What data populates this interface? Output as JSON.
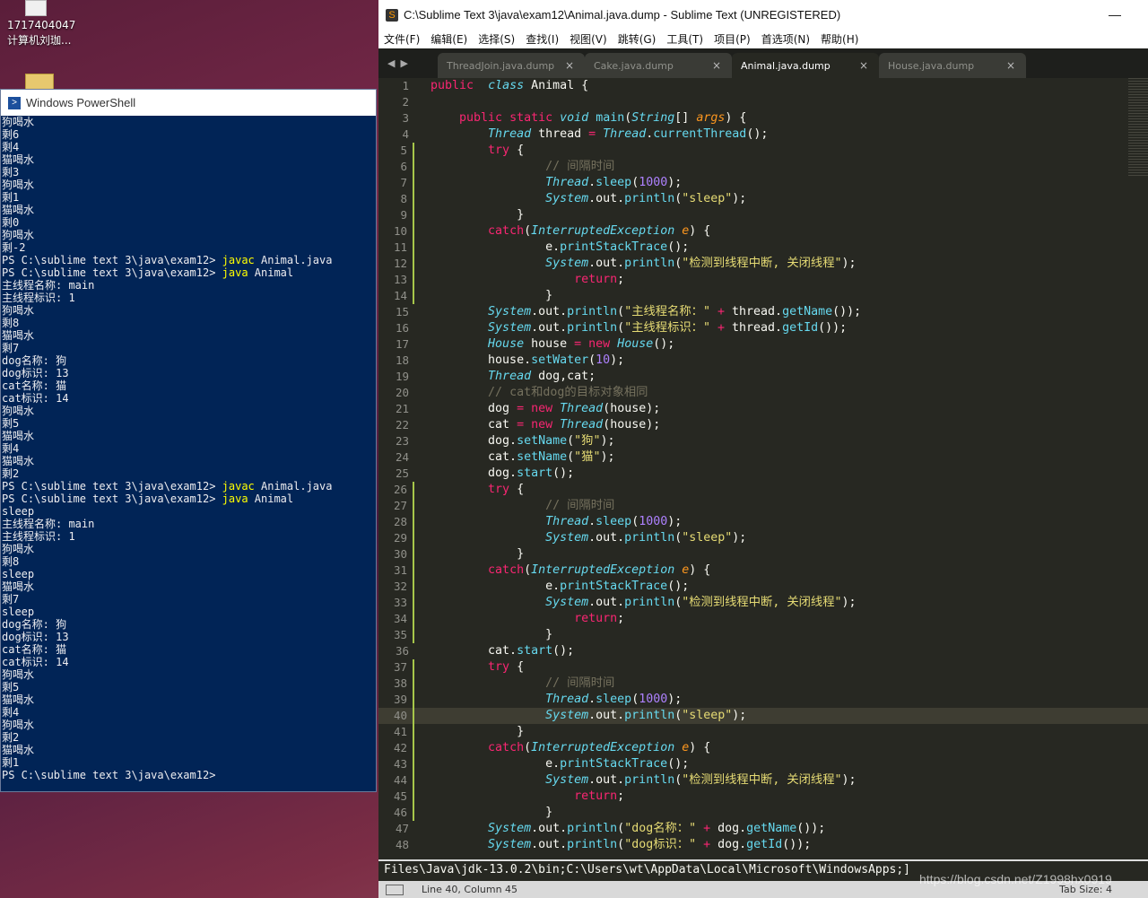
{
  "desktop": {
    "icon_label_line1": "1717404047",
    "icon_label_line2": "计算机刘珈..."
  },
  "powershell": {
    "title": "Windows PowerShell",
    "lines": [
      {
        "text": "狗喝水"
      },
      {
        "text": "剩6"
      },
      {
        "text": "剩4"
      },
      {
        "text": "猫喝水"
      },
      {
        "text": "剩3"
      },
      {
        "text": "狗喝水"
      },
      {
        "text": "剩1"
      },
      {
        "text": "猫喝水"
      },
      {
        "text": "剩0"
      },
      {
        "text": "狗喝水"
      },
      {
        "text": "剩-2"
      },
      {
        "prompt": "PS C:\\sublime text 3\\java\\exam12> ",
        "cmd": "javac",
        "arg": " Animal.java"
      },
      {
        "prompt": "PS C:\\sublime text 3\\java\\exam12> ",
        "cmd": "java",
        "arg": " Animal"
      },
      {
        "text": "主线程名称: main"
      },
      {
        "text": "主线程标识: 1"
      },
      {
        "text": "狗喝水"
      },
      {
        "text": "剩8"
      },
      {
        "text": "猫喝水"
      },
      {
        "text": "剩7"
      },
      {
        "text": "dog名称: 狗"
      },
      {
        "text": "dog标识: 13"
      },
      {
        "text": "cat名称: 猫"
      },
      {
        "text": "cat标识: 14"
      },
      {
        "text": "狗喝水"
      },
      {
        "text": "剩5"
      },
      {
        "text": "猫喝水"
      },
      {
        "text": "剩4"
      },
      {
        "text": "猫喝水"
      },
      {
        "text": "剩2"
      },
      {
        "prompt": "PS C:\\sublime text 3\\java\\exam12> ",
        "cmd": "javac",
        "arg": " Animal.java"
      },
      {
        "prompt": "PS C:\\sublime text 3\\java\\exam12> ",
        "cmd": "java",
        "arg": " Animal"
      },
      {
        "text": "sleep"
      },
      {
        "text": "主线程名称: main"
      },
      {
        "text": "主线程标识: 1"
      },
      {
        "text": "狗喝水"
      },
      {
        "text": "剩8"
      },
      {
        "text": "sleep"
      },
      {
        "text": "猫喝水"
      },
      {
        "text": "剩7"
      },
      {
        "text": "sleep"
      },
      {
        "text": "dog名称: 狗"
      },
      {
        "text": "dog标识: 13"
      },
      {
        "text": "cat名称: 猫"
      },
      {
        "text": "cat标识: 14"
      },
      {
        "text": "狗喝水"
      },
      {
        "text": "剩5"
      },
      {
        "text": "猫喝水"
      },
      {
        "text": "剩4"
      },
      {
        "text": "狗喝水"
      },
      {
        "text": "剩2"
      },
      {
        "text": "猫喝水"
      },
      {
        "text": "剩1"
      },
      {
        "text": "PS C:\\sublime text 3\\java\\exam12>"
      }
    ]
  },
  "sublime": {
    "title": "C:\\Sublime Text 3\\java\\exam12\\Animal.java.dump - Sublime Text (UNREGISTERED)",
    "minimize": "—",
    "menu": [
      "文件(F)",
      "编辑(E)",
      "选择(S)",
      "查找(I)",
      "视图(V)",
      "跳转(G)",
      "工具(T)",
      "项目(P)",
      "首选项(N)",
      "帮助(H)"
    ],
    "tabs": [
      {
        "label": "ThreadJoin.java.dump",
        "active": false
      },
      {
        "label": "Cake.java.dump",
        "active": false
      },
      {
        "label": "Animal.java.dump",
        "active": true
      },
      {
        "label": "House.java.dump",
        "active": false
      }
    ],
    "tab_close": "×",
    "code_lines": [
      [
        [
          "kw",
          "public"
        ],
        [
          "",
          "  "
        ],
        [
          "st",
          "class"
        ],
        [
          "",
          " Animal {"
        ]
      ],
      [],
      [
        [
          "",
          "    "
        ],
        [
          "kw",
          "public"
        ],
        [
          "",
          " "
        ],
        [
          "kw",
          "static"
        ],
        [
          "",
          " "
        ],
        [
          "st",
          "void"
        ],
        [
          "",
          " "
        ],
        [
          "fn",
          "main"
        ],
        [
          "",
          "("
        ],
        [
          "st",
          "String"
        ],
        [
          "",
          "[] "
        ],
        [
          "pm",
          "args"
        ],
        [
          "",
          ") {"
        ]
      ],
      [
        [
          "",
          "        "
        ],
        [
          "st",
          "Thread"
        ],
        [
          "",
          " thread "
        ],
        [
          "kw",
          "="
        ],
        [
          "",
          " "
        ],
        [
          "st",
          "Thread"
        ],
        [
          "",
          "."
        ],
        [
          "fn",
          "currentThread"
        ],
        [
          "",
          "();"
        ]
      ],
      [
        [
          "",
          "        "
        ],
        [
          "kw",
          "try"
        ],
        [
          "",
          " {"
        ]
      ],
      [
        [
          "",
          "                "
        ],
        [
          "cm",
          "// 间隔时间"
        ]
      ],
      [
        [
          "",
          "                "
        ],
        [
          "st",
          "Thread"
        ],
        [
          "",
          "."
        ],
        [
          "fn",
          "sleep"
        ],
        [
          "",
          "("
        ],
        [
          "num",
          "1000"
        ],
        [
          "",
          ");"
        ]
      ],
      [
        [
          "",
          "                "
        ],
        [
          "st",
          "System"
        ],
        [
          "",
          ".out."
        ],
        [
          "fn",
          "println"
        ],
        [
          "",
          "("
        ],
        [
          "str",
          "\"sleep\""
        ],
        [
          "",
          ");"
        ]
      ],
      [
        [
          "",
          "            }"
        ]
      ],
      [
        [
          "",
          "        "
        ],
        [
          "kw",
          "catch"
        ],
        [
          "",
          "("
        ],
        [
          "st",
          "InterruptedException"
        ],
        [
          "",
          " "
        ],
        [
          "pm",
          "e"
        ],
        [
          "",
          ") {"
        ]
      ],
      [
        [
          "",
          "                e."
        ],
        [
          "fn",
          "printStackTrace"
        ],
        [
          "",
          "();"
        ]
      ],
      [
        [
          "",
          "                "
        ],
        [
          "st",
          "System"
        ],
        [
          "",
          ".out."
        ],
        [
          "fn",
          "println"
        ],
        [
          "",
          "("
        ],
        [
          "str",
          "\"检测到线程中断, 关闭线程\""
        ],
        [
          "",
          ");"
        ]
      ],
      [
        [
          "",
          "                    "
        ],
        [
          "kw",
          "return"
        ],
        [
          "",
          ";"
        ]
      ],
      [
        [
          "",
          "                }"
        ]
      ],
      [
        [
          "",
          "        "
        ],
        [
          "st",
          "System"
        ],
        [
          "",
          ".out."
        ],
        [
          "fn",
          "println"
        ],
        [
          "",
          "("
        ],
        [
          "str",
          "\"主线程名称：\""
        ],
        [
          "",
          " "
        ],
        [
          "kw",
          "+"
        ],
        [
          "",
          " thread."
        ],
        [
          "fn",
          "getName"
        ],
        [
          "",
          "());"
        ]
      ],
      [
        [
          "",
          "        "
        ],
        [
          "st",
          "System"
        ],
        [
          "",
          ".out."
        ],
        [
          "fn",
          "println"
        ],
        [
          "",
          "("
        ],
        [
          "str",
          "\"主线程标识：\""
        ],
        [
          "",
          " "
        ],
        [
          "kw",
          "+"
        ],
        [
          "",
          " thread."
        ],
        [
          "fn",
          "getId"
        ],
        [
          "",
          "());"
        ]
      ],
      [
        [
          "",
          "        "
        ],
        [
          "st",
          "House"
        ],
        [
          "",
          " house "
        ],
        [
          "kw",
          "="
        ],
        [
          "",
          " "
        ],
        [
          "kw",
          "new"
        ],
        [
          "",
          " "
        ],
        [
          "st",
          "House"
        ],
        [
          "",
          "();"
        ]
      ],
      [
        [
          "",
          "        house."
        ],
        [
          "fn",
          "setWater"
        ],
        [
          "",
          "("
        ],
        [
          "num",
          "10"
        ],
        [
          "",
          ");"
        ]
      ],
      [
        [
          "",
          "        "
        ],
        [
          "st",
          "Thread"
        ],
        [
          "",
          " dog,cat;"
        ]
      ],
      [
        [
          "",
          "        "
        ],
        [
          "cm",
          "// cat和dog的目标对象相同"
        ]
      ],
      [
        [
          "",
          "        dog "
        ],
        [
          "kw",
          "="
        ],
        [
          "",
          " "
        ],
        [
          "kw",
          "new"
        ],
        [
          "",
          " "
        ],
        [
          "st",
          "Thread"
        ],
        [
          "",
          "(house);"
        ]
      ],
      [
        [
          "",
          "        cat "
        ],
        [
          "kw",
          "="
        ],
        [
          "",
          " "
        ],
        [
          "kw",
          "new"
        ],
        [
          "",
          " "
        ],
        [
          "st",
          "Thread"
        ],
        [
          "",
          "(house);"
        ]
      ],
      [
        [
          "",
          "        dog."
        ],
        [
          "fn",
          "setName"
        ],
        [
          "",
          "("
        ],
        [
          "str",
          "\"狗\""
        ],
        [
          "",
          ");"
        ]
      ],
      [
        [
          "",
          "        cat."
        ],
        [
          "fn",
          "setName"
        ],
        [
          "",
          "("
        ],
        [
          "str",
          "\"猫\""
        ],
        [
          "",
          ");"
        ]
      ],
      [
        [
          "",
          "        dog."
        ],
        [
          "fn",
          "start"
        ],
        [
          "",
          "();"
        ]
      ],
      [
        [
          "",
          "        "
        ],
        [
          "kw",
          "try"
        ],
        [
          "",
          " {"
        ]
      ],
      [
        [
          "",
          "                "
        ],
        [
          "cm",
          "// 间隔时间"
        ]
      ],
      [
        [
          "",
          "                "
        ],
        [
          "st",
          "Thread"
        ],
        [
          "",
          "."
        ],
        [
          "fn",
          "sleep"
        ],
        [
          "",
          "("
        ],
        [
          "num",
          "1000"
        ],
        [
          "",
          ");"
        ]
      ],
      [
        [
          "",
          "                "
        ],
        [
          "st",
          "System"
        ],
        [
          "",
          ".out."
        ],
        [
          "fn",
          "println"
        ],
        [
          "",
          "("
        ],
        [
          "str",
          "\"sleep\""
        ],
        [
          "",
          ");"
        ]
      ],
      [
        [
          "",
          "            }"
        ]
      ],
      [
        [
          "",
          "        "
        ],
        [
          "kw",
          "catch"
        ],
        [
          "",
          "("
        ],
        [
          "st",
          "InterruptedException"
        ],
        [
          "",
          " "
        ],
        [
          "pm",
          "e"
        ],
        [
          "",
          ") {"
        ]
      ],
      [
        [
          "",
          "                e."
        ],
        [
          "fn",
          "printStackTrace"
        ],
        [
          "",
          "();"
        ]
      ],
      [
        [
          "",
          "                "
        ],
        [
          "st",
          "System"
        ],
        [
          "",
          ".out."
        ],
        [
          "fn",
          "println"
        ],
        [
          "",
          "("
        ],
        [
          "str",
          "\"检测到线程中断, 关闭线程\""
        ],
        [
          "",
          ");"
        ]
      ],
      [
        [
          "",
          "                    "
        ],
        [
          "kw",
          "return"
        ],
        [
          "",
          ";"
        ]
      ],
      [
        [
          "",
          "                }"
        ]
      ],
      [
        [
          "",
          "        cat."
        ],
        [
          "fn",
          "start"
        ],
        [
          "",
          "();"
        ]
      ],
      [
        [
          "",
          "        "
        ],
        [
          "kw",
          "try"
        ],
        [
          "",
          " {"
        ]
      ],
      [
        [
          "",
          "                "
        ],
        [
          "cm",
          "// 间隔时间"
        ]
      ],
      [
        [
          "",
          "                "
        ],
        [
          "st",
          "Thread"
        ],
        [
          "",
          "."
        ],
        [
          "fn",
          "sleep"
        ],
        [
          "",
          "("
        ],
        [
          "num",
          "1000"
        ],
        [
          "",
          ");"
        ]
      ],
      [
        [
          "",
          "                "
        ],
        [
          "st",
          "System"
        ],
        [
          "",
          ".out."
        ],
        [
          "fn",
          "println"
        ],
        [
          "",
          "("
        ],
        [
          "str",
          "\"sleep\""
        ],
        [
          "",
          ");"
        ]
      ],
      [
        [
          "",
          "            }"
        ]
      ],
      [
        [
          "",
          "        "
        ],
        [
          "kw",
          "catch"
        ],
        [
          "",
          "("
        ],
        [
          "st",
          "InterruptedException"
        ],
        [
          "",
          " "
        ],
        [
          "pm",
          "e"
        ],
        [
          "",
          ") {"
        ]
      ],
      [
        [
          "",
          "                e."
        ],
        [
          "fn",
          "printStackTrace"
        ],
        [
          "",
          "();"
        ]
      ],
      [
        [
          "",
          "                "
        ],
        [
          "st",
          "System"
        ],
        [
          "",
          ".out."
        ],
        [
          "fn",
          "println"
        ],
        [
          "",
          "("
        ],
        [
          "str",
          "\"检测到线程中断, 关闭线程\""
        ],
        [
          "",
          ");"
        ]
      ],
      [
        [
          "",
          "                    "
        ],
        [
          "kw",
          "return"
        ],
        [
          "",
          ";"
        ]
      ],
      [
        [
          "",
          "                }"
        ]
      ],
      [
        [
          "",
          "        "
        ],
        [
          "st",
          "System"
        ],
        [
          "",
          ".out."
        ],
        [
          "fn",
          "println"
        ],
        [
          "",
          "("
        ],
        [
          "str",
          "\"dog名称：\""
        ],
        [
          "",
          " "
        ],
        [
          "kw",
          "+"
        ],
        [
          "",
          " dog."
        ],
        [
          "fn",
          "getName"
        ],
        [
          "",
          "());"
        ]
      ],
      [
        [
          "",
          "        "
        ],
        [
          "st",
          "System"
        ],
        [
          "",
          ".out."
        ],
        [
          "fn",
          "println"
        ],
        [
          "",
          "("
        ],
        [
          "str",
          "\"dog标识：\""
        ],
        [
          "",
          " "
        ],
        [
          "kw",
          "+"
        ],
        [
          "",
          " dog."
        ],
        [
          "fn",
          "getId"
        ],
        [
          "",
          "());"
        ]
      ]
    ],
    "modified_lines": [
      5,
      6,
      7,
      8,
      9,
      10,
      11,
      12,
      13,
      14,
      26,
      27,
      28,
      29,
      30,
      31,
      32,
      33,
      34,
      35,
      37,
      38,
      39,
      40,
      41,
      42,
      43,
      44,
      45,
      46
    ],
    "current_line": 40,
    "console_text": "Files\\Java\\jdk-13.0.2\\bin;C:\\Users\\wt\\AppData\\Local\\Microsoft\\WindowsApps;]",
    "status_position": "Line 40, Column 45",
    "status_tabsize": "Tab Size: 4"
  },
  "watermark": "https://blog.csdn.net/Z1998hx0919",
  "colors": {
    "powershell_bg": "#012456",
    "editor_bg": "#272822",
    "keyword": "#f92672",
    "type": "#66d9ef",
    "string": "#e6db74",
    "number": "#ae81ff",
    "comment": "#75715e"
  }
}
